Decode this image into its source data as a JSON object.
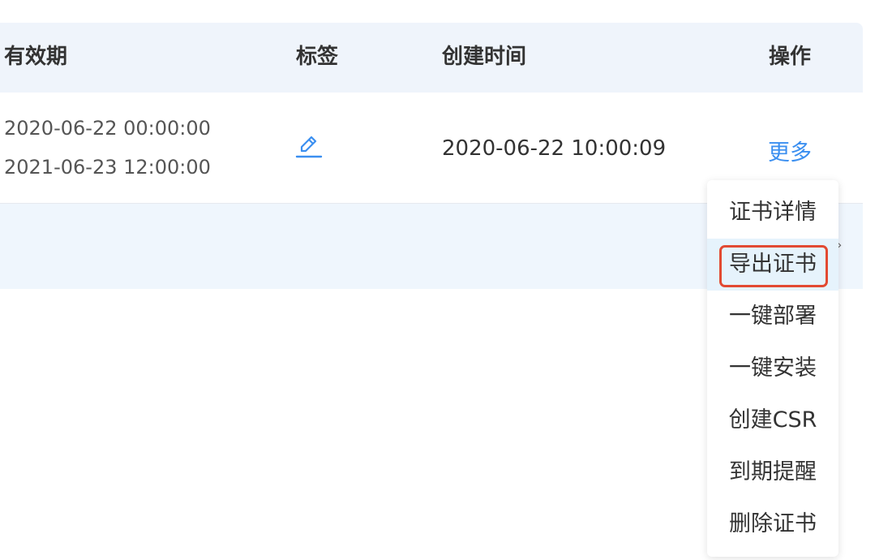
{
  "table": {
    "headers": {
      "validity": "有效期",
      "tags": "标签",
      "created": "创建时间",
      "actions": "操作"
    },
    "row": {
      "validity_start": "2020-06-22 00:00:00",
      "validity_end": "2021-06-23 12:00:00",
      "tag_icon": "pencil-icon",
      "created_time": "2020-06-22 10:00:09",
      "more_label": "更多"
    }
  },
  "dropdown": {
    "items": [
      {
        "label": "证书详情"
      },
      {
        "label": "导出证书",
        "highlighted": true
      },
      {
        "label": "一键部署"
      },
      {
        "label": "一键安装"
      },
      {
        "label": "创建CSR"
      },
      {
        "label": "到期提醒"
      },
      {
        "label": "删除证书"
      }
    ]
  },
  "colors": {
    "accent": "#3b8ff0",
    "header_bg": "#eff4fb",
    "hover_bg": "#e6f3fc",
    "highlight_border": "#e24a32"
  }
}
